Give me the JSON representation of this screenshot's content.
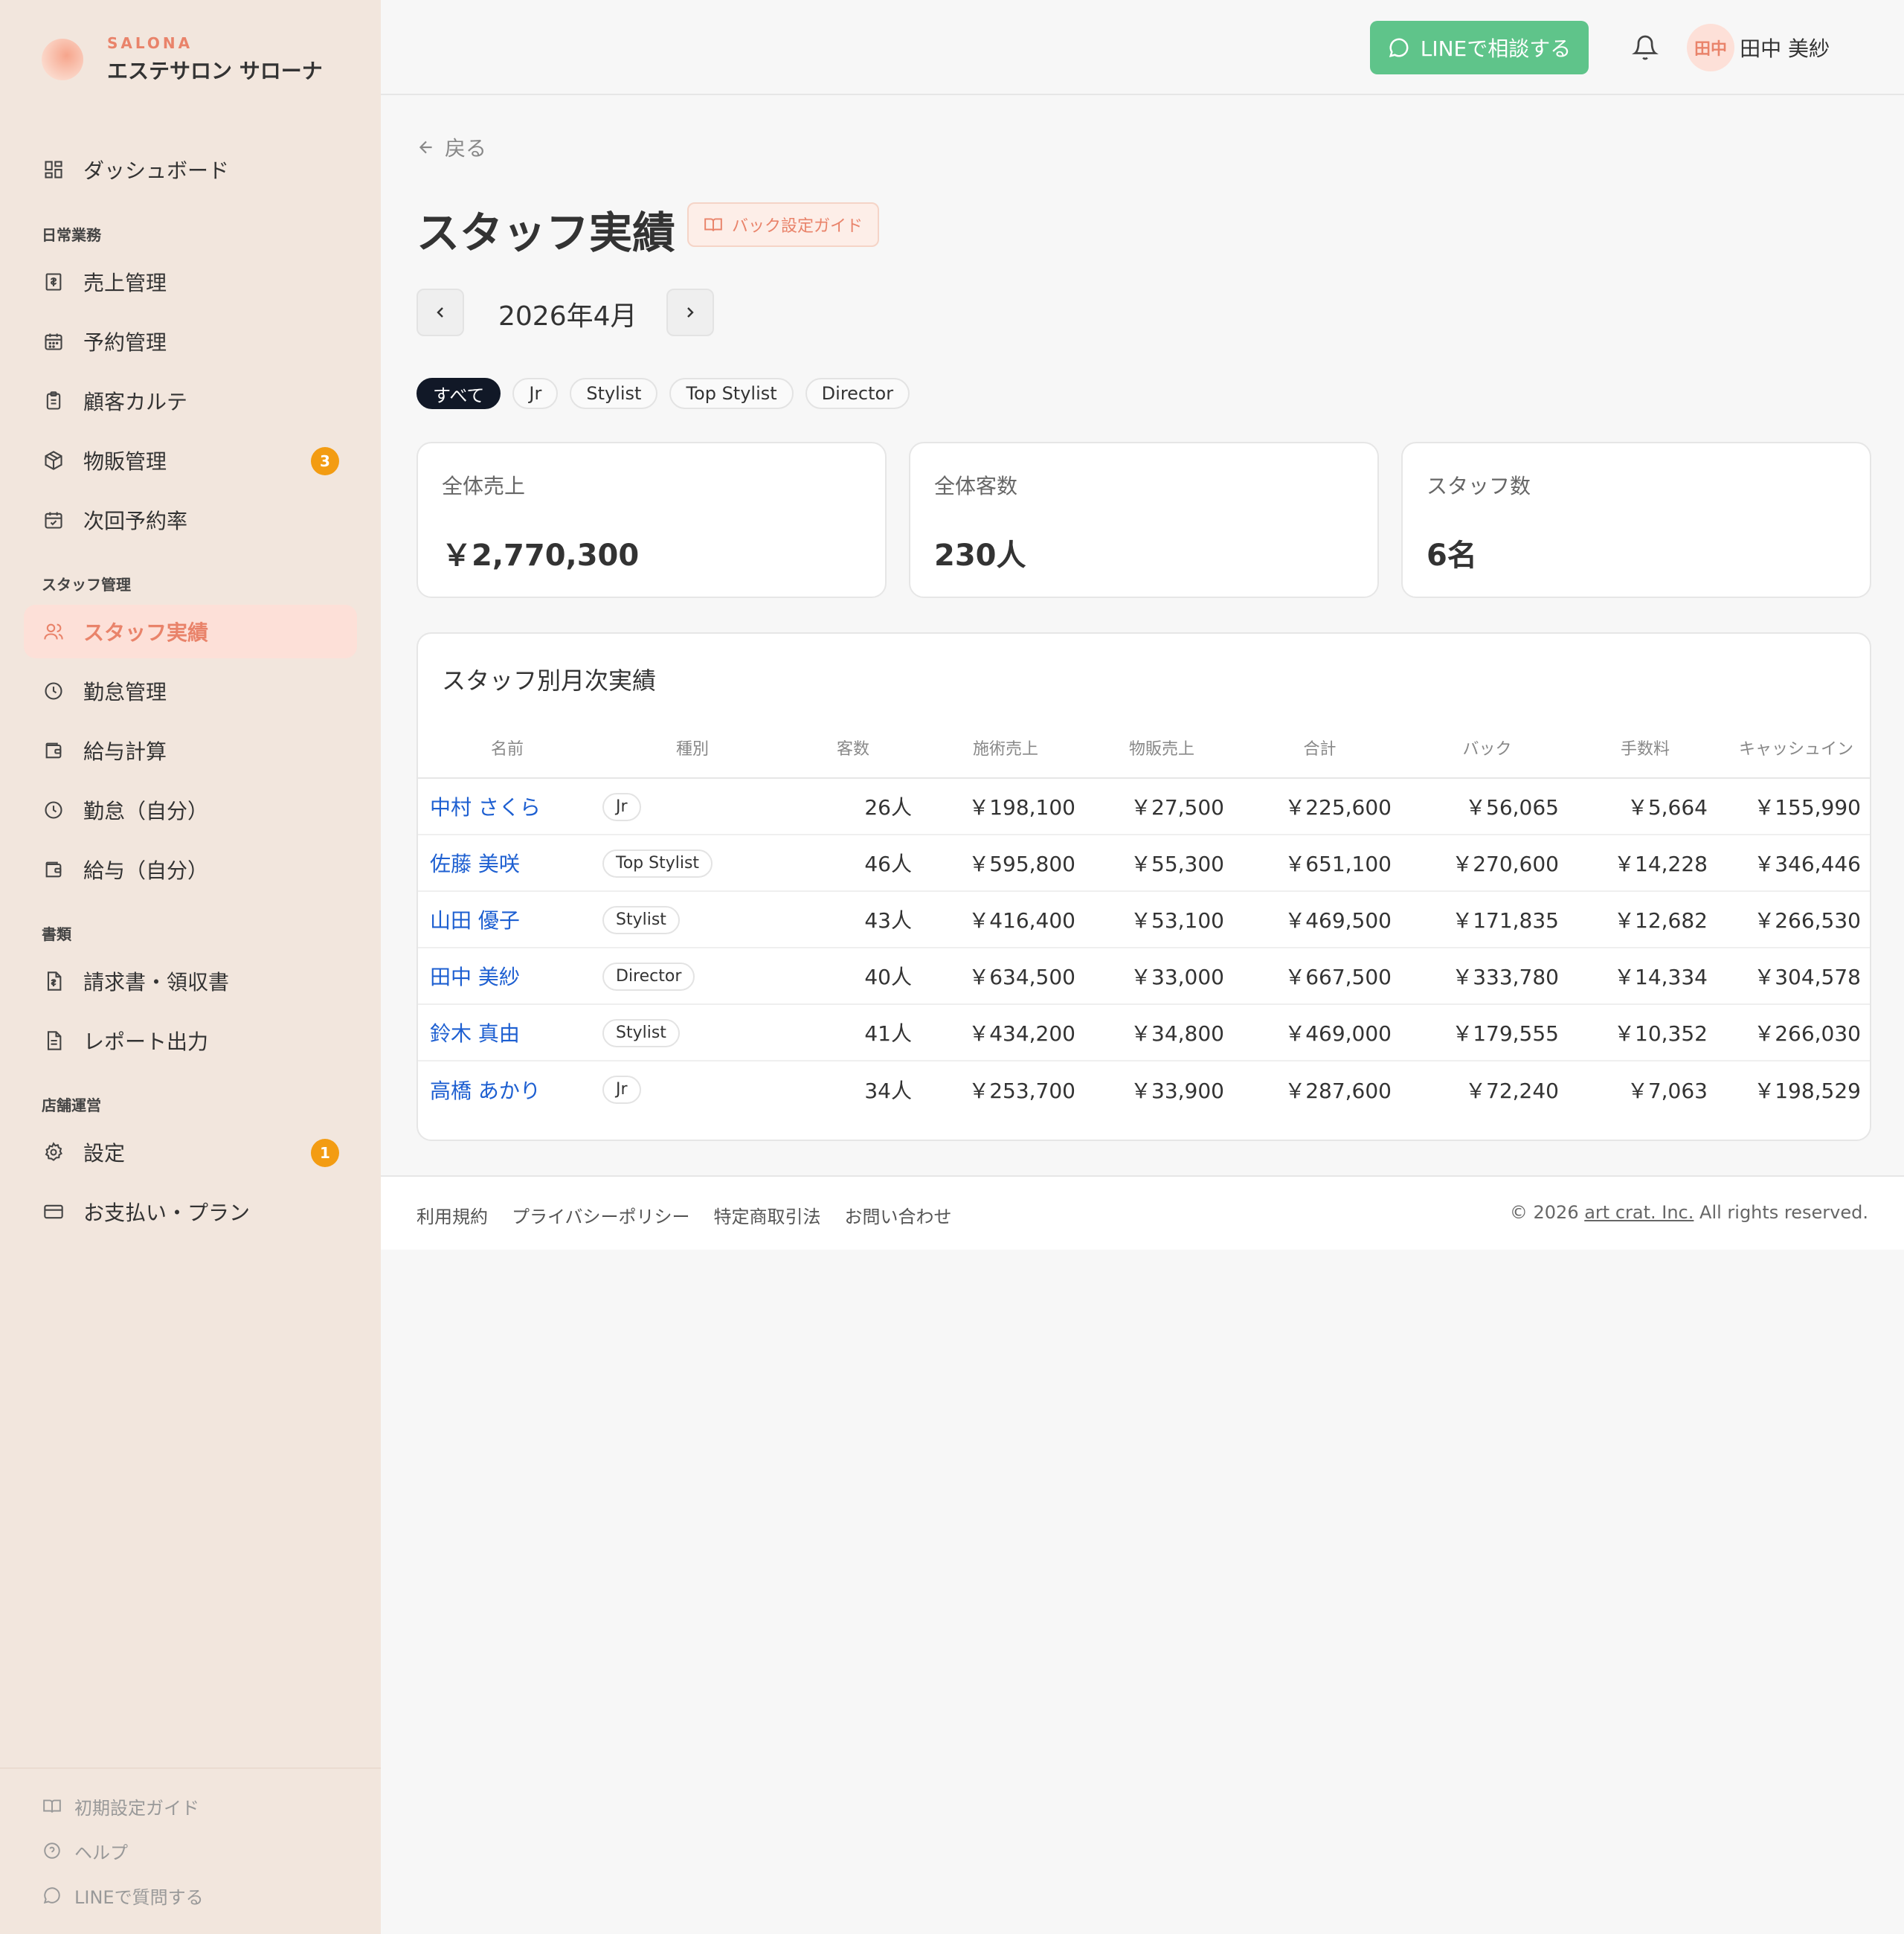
{
  "brand": {
    "en": "SALONA",
    "ja": "エステサロン サローナ"
  },
  "sidebar": {
    "dashboard": "ダッシュボード",
    "sections": {
      "daily": "日常業務",
      "staff": "スタッフ管理",
      "docs": "書類",
      "store": "店舗運営"
    },
    "items": {
      "sales": "売上管理",
      "reservation": "予約管理",
      "karte": "顧客カルテ",
      "retail": "物販管理",
      "retail_badge": "3",
      "next_rate": "次回予約率",
      "staff_perf": "スタッフ実績",
      "attendance": "勤怠管理",
      "payroll": "給与計算",
      "my_attendance": "勤怠（自分）",
      "my_salary": "給与（自分）",
      "invoice": "請求書・領収書",
      "report": "レポート出力",
      "settings": "設定",
      "settings_badge": "1",
      "payment": "お支払い・プラン"
    },
    "footer": {
      "setup_guide": "初期設定ガイド",
      "help": "ヘルプ",
      "line_question": "LINEで質問する"
    }
  },
  "header": {
    "line_button": "LINEで相談する",
    "avatar_initials": "田中",
    "user_name": "田中 美紗"
  },
  "main": {
    "back": "戻る",
    "title": "スタッフ実績",
    "guide_button": "バック設定ガイド",
    "month": "2026年4月",
    "filters": [
      "すべて",
      "Jr",
      "Stylist",
      "Top Stylist",
      "Director"
    ],
    "stats": [
      {
        "label": "全体売上",
        "value": "￥2,770,300"
      },
      {
        "label": "全体客数",
        "value": "230人"
      },
      {
        "label": "スタッフ数",
        "value": "6名"
      }
    ],
    "table": {
      "title": "スタッフ別月次実績",
      "headers": [
        "名前",
        "種別",
        "客数",
        "施術売上",
        "物販売上",
        "合計",
        "バック",
        "手数料",
        "キャッシュイン"
      ],
      "rows": [
        [
          "中村 さくら",
          "Jr",
          "26人",
          "￥198,100",
          "￥27,500",
          "￥225,600",
          "￥56,065",
          "￥5,664",
          "￥155,990"
        ],
        [
          "佐藤 美咲",
          "Top Stylist",
          "46人",
          "￥595,800",
          "￥55,300",
          "￥651,100",
          "￥270,600",
          "￥14,228",
          "￥346,446"
        ],
        [
          "山田 優子",
          "Stylist",
          "43人",
          "￥416,400",
          "￥53,100",
          "￥469,500",
          "￥171,835",
          "￥12,682",
          "￥266,530"
        ],
        [
          "田中 美紗",
          "Director",
          "40人",
          "￥634,500",
          "￥33,000",
          "￥667,500",
          "￥333,780",
          "￥14,334",
          "￥304,578"
        ],
        [
          "鈴木 真由",
          "Stylist",
          "41人",
          "￥434,200",
          "￥34,800",
          "￥469,000",
          "￥179,555",
          "￥10,352",
          "￥266,030"
        ],
        [
          "高橋 あかり",
          "Jr",
          "34人",
          "￥253,700",
          "￥33,900",
          "￥287,600",
          "￥72,240",
          "￥7,063",
          "￥198,529"
        ]
      ]
    }
  },
  "footer": {
    "links": [
      "利用規約",
      "プライバシーポリシー",
      "特定商取引法",
      "お問い合わせ"
    ],
    "copy_prefix": "© 2026 ",
    "company": "art crat. Inc.",
    "copy_suffix": " All rights reserved."
  },
  "colors": {
    "accent": "#e9836a",
    "line_green": "#5fc48a",
    "badge": "#f39c12",
    "link": "#1d5fd1",
    "sidebar_bg": "#f2e6dd"
  }
}
